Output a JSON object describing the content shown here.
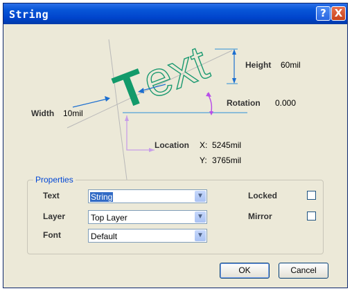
{
  "window": {
    "title": "String"
  },
  "titlebar_buttons": {
    "help": "?",
    "close": "X"
  },
  "diagram": {
    "sample_text": "Text",
    "height_label": "Height",
    "height_value": "60mil",
    "rotation_label": "Rotation",
    "rotation_value": "0.000",
    "width_label": "Width",
    "width_value": "10mil",
    "location_label": "Location",
    "x_label": "X:",
    "x_value": "5245mil",
    "y_label": "Y:",
    "y_value": "3765mil",
    "colors": {
      "text_fill": "#129a6a",
      "accent": "#1a9970",
      "dimension": "#1b6ed0",
      "rotation_arc": "#b84ee8",
      "location_marker": "#c79de8"
    }
  },
  "properties": {
    "legend": "Properties",
    "text_label": "Text",
    "text_value": "String",
    "layer_label": "Layer",
    "layer_value": "Top Layer",
    "font_label": "Font",
    "font_value": "Default",
    "locked_label": "Locked",
    "locked_checked": false,
    "mirror_label": "Mirror",
    "mirror_checked": false
  },
  "buttons": {
    "ok": "OK",
    "cancel": "Cancel"
  }
}
